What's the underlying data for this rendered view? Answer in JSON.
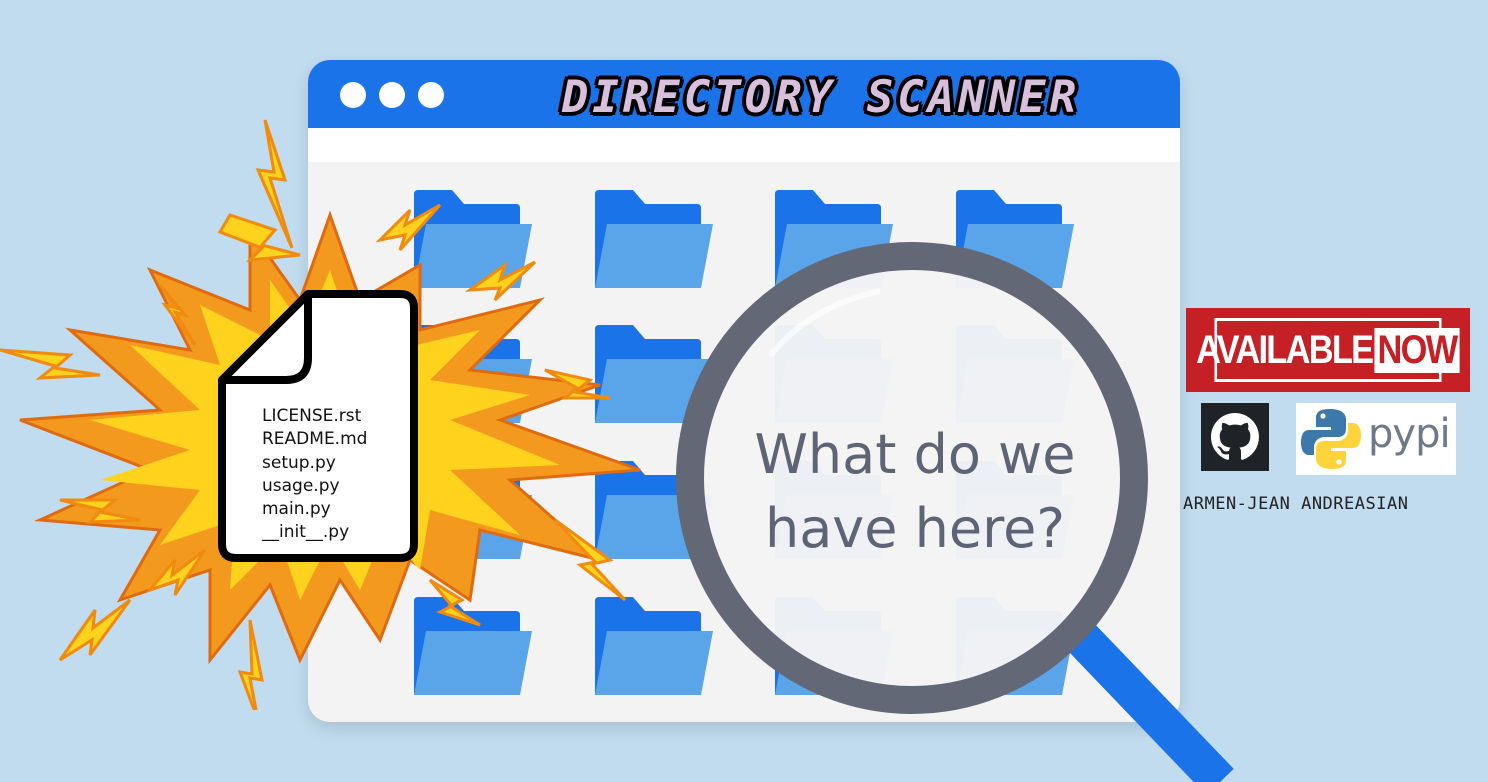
{
  "window": {
    "title": "Directory Scanner",
    "colors": {
      "titlebar": "#1a73e8",
      "folder_back": "#1a73e8",
      "folder_front": "#5aa4ea"
    }
  },
  "file_card": {
    "files": [
      "LICENSE.rst",
      "README.md",
      "setup.py",
      "usage.py",
      "main.py",
      "__init__.py"
    ]
  },
  "magnifier": {
    "line1": "What do we",
    "line2": "have here?"
  },
  "badge": {
    "part1": "AVAILABLE",
    "part2": "NOW",
    "color": "#c42026"
  },
  "links": {
    "github_icon": "github-icon",
    "pypi_label": "pypi",
    "python_icon": "python-icon"
  },
  "author": "Armen-Jean Andreasian"
}
